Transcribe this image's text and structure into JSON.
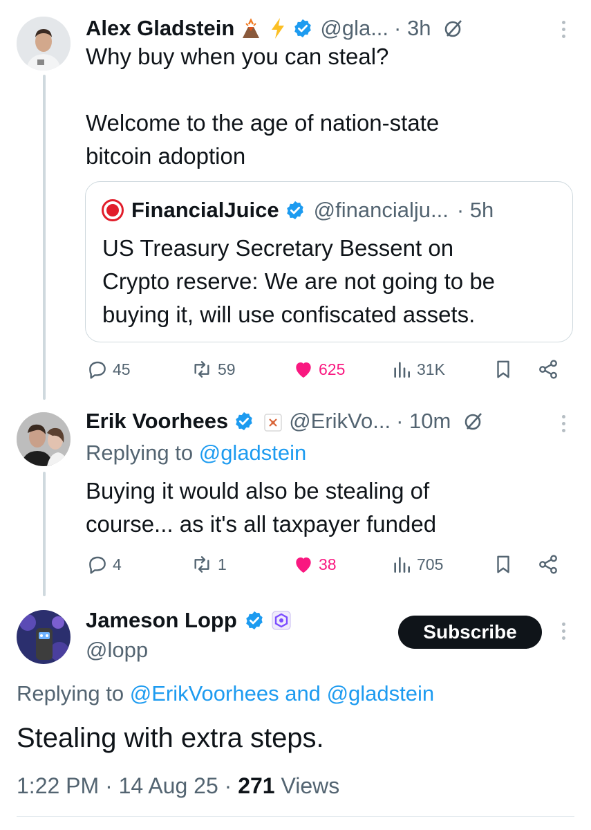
{
  "tweet1": {
    "name": "Alex Gladstein",
    "emoji": "🌋⚡",
    "handle": "@gla...",
    "time": "· 3h",
    "text_line1": "Why buy when you can steal?",
    "text_line2": "Welcome to the age of nation-state",
    "text_line3": "bitcoin adoption",
    "quote": {
      "name": "FinancialJuice",
      "handle": "@financialju...",
      "time": "· 5h",
      "line1": "US Treasury Secretary Bessent on",
      "line2": "Crypto reserve: We are not going to be",
      "line3": "buying it, will use confiscated assets."
    },
    "actions": {
      "replies": "45",
      "reposts": "59",
      "likes": "625",
      "views": "31K"
    }
  },
  "tweet2": {
    "name": "Erik Voorhees",
    "handle": "@ErikVo...",
    "time": "· 10m",
    "replying_prefix": "Replying to",
    "replying_handle": "@gladstein",
    "text_line1": "Buying it would also be stealing of",
    "text_line2": "course... as it's all taxpayer funded",
    "actions": {
      "replies": "4",
      "reposts": "1",
      "likes": "38",
      "views": "705"
    }
  },
  "tweet3": {
    "name": "Jameson Lopp",
    "handle": "@lopp",
    "subscribe_label": "Subscribe",
    "replying_prefix": "Replying to",
    "replying_handle1": "@ErikVoorhees",
    "replying_and": "and",
    "replying_handle2": "@gladstein",
    "text": "Stealing with extra steps.",
    "meta_time": "1:22 PM · 14 Aug 25 ·",
    "meta_views_count": "271",
    "meta_views_label": "Views"
  },
  "colors": {
    "accent": "#1d9bf0",
    "like": "#f91880",
    "muted": "#536471",
    "text": "#0f1419",
    "line": "#cfd9de"
  },
  "icons": [
    "verified-badge-icon",
    "grok-icon",
    "more-icon",
    "reply-icon",
    "repost-icon",
    "like-icon",
    "views-icon",
    "bookmark-icon",
    "share-icon",
    "volcano-emoji",
    "lightning-emoji",
    "financialjuice-logo-icon",
    "affiliate-badge-icon"
  ]
}
